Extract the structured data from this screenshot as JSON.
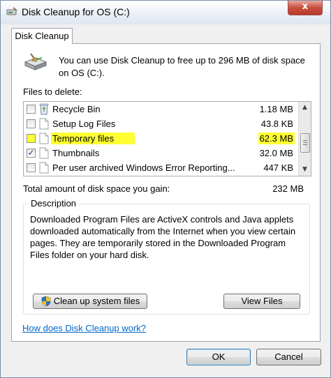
{
  "window": {
    "title": "Disk Cleanup for OS (C:)",
    "close_label": "x"
  },
  "tabs": [
    {
      "label": "Disk Cleanup"
    }
  ],
  "main": {
    "intro_text": "You can use Disk Cleanup to free up to 296 MB of disk space on OS (C:).",
    "files_label": "Files to delete:",
    "file_items": [
      {
        "name": "Recycle Bin",
        "size": "1.18 MB",
        "checked": false,
        "icon": "recycle-bin-icon",
        "highlighted": false
      },
      {
        "name": "Setup Log Files",
        "size": "43.8 KB",
        "checked": false,
        "icon": "file-icon",
        "highlighted": false
      },
      {
        "name": "Temporary files",
        "size": "62.3 MB",
        "checked": false,
        "icon": "file-icon",
        "highlighted": true
      },
      {
        "name": "Thumbnails",
        "size": "32.0 MB",
        "checked": true,
        "icon": "file-icon",
        "highlighted": false
      },
      {
        "name": "Per user archived Windows Error Reporting...",
        "size": "447 KB",
        "checked": false,
        "icon": "file-icon",
        "highlighted": false
      }
    ],
    "total_label": "Total amount of disk space you gain:",
    "total_value": "232 MB",
    "description": {
      "legend": "Description",
      "text": "Downloaded Program Files are ActiveX controls and Java applets downloaded automatically from the Internet when you view certain pages. They are temporarily stored in the Downloaded Program Files folder on your hard disk."
    },
    "cleanup_system_button": "Clean up system files",
    "view_files_button": "View Files",
    "help_link": "How does Disk Cleanup work?"
  },
  "footer": {
    "ok_label": "OK",
    "cancel_label": "Cancel"
  },
  "colors": {
    "highlight": "#ffff33",
    "link": "#0066cc",
    "close_button": "#c7503f"
  }
}
